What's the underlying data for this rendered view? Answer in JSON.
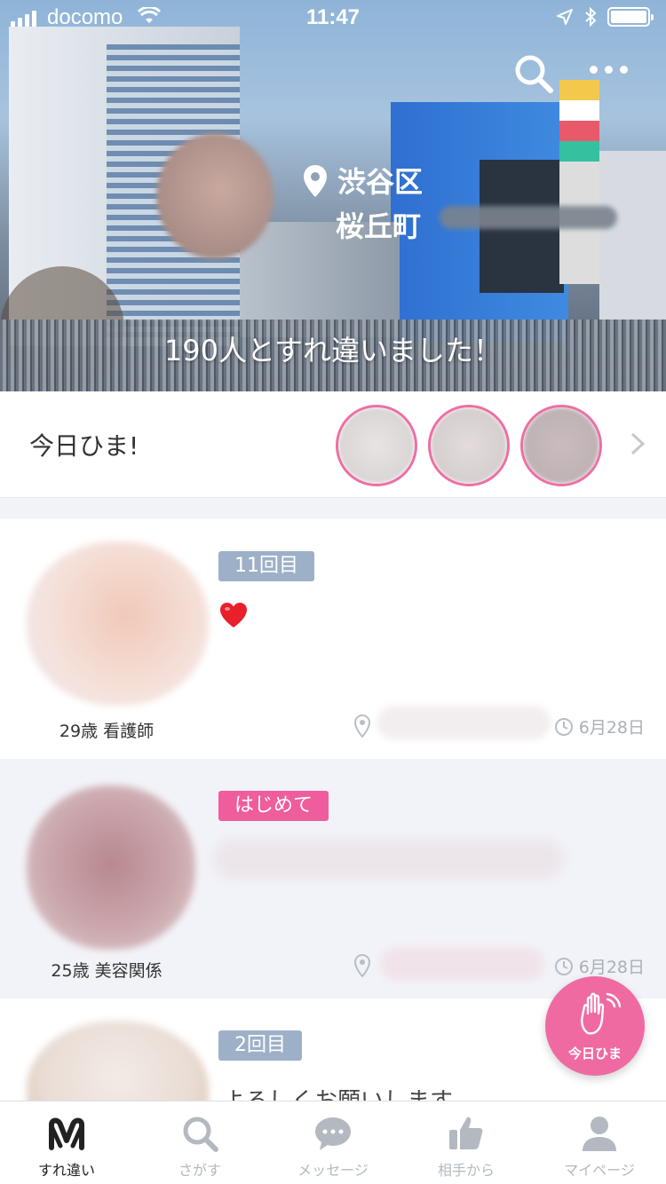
{
  "status_bar": {
    "carrier": "docomo",
    "time": "11:47"
  },
  "hero": {
    "ward": "渋谷区",
    "town": "桜丘町",
    "passed_count_text": "190人とすれ違いました！",
    "search_icon": "search-icon",
    "more_icon": "more-icon"
  },
  "today": {
    "label": "今日ひま!"
  },
  "cards": [
    {
      "badge": "11回目",
      "badge_type": "count",
      "message_icon": "heart-emoji",
      "meta": "29歳 看護師",
      "date": "6月28日"
    },
    {
      "badge": "はじめて",
      "badge_type": "new",
      "meta": "25歳 美容関係",
      "date": "6月28日"
    },
    {
      "badge": "2回目",
      "badge_type": "count",
      "message": "よろしくお願いします"
    }
  ],
  "fab": {
    "label": "今日ひま",
    "icon": "wave-hand-icon",
    "color": "#f06aa2"
  },
  "tabbar": {
    "items": [
      {
        "label": "すれ違い",
        "icon": "pass-icon",
        "active": true
      },
      {
        "label": "さがす",
        "icon": "search-icon"
      },
      {
        "label": "メッセージ",
        "icon": "chat-bubble-icon"
      },
      {
        "label": "相手から",
        "icon": "thumbs-up-icon"
      },
      {
        "label": "マイページ",
        "icon": "person-icon"
      }
    ]
  },
  "colors": {
    "accent_pink": "#ef5d9c",
    "badge_blue": "#9db0c8",
    "tab_inactive": "#b4b9c1"
  }
}
